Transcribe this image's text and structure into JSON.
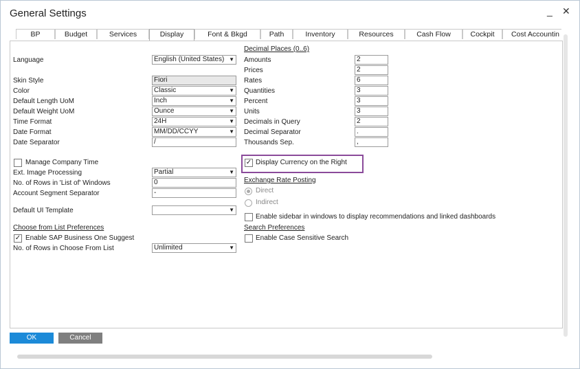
{
  "window": {
    "title": "General Settings",
    "minimize": "_",
    "close": "✕"
  },
  "tabs": [
    "BP",
    "Budget",
    "Services",
    "Display",
    "Font & Bkgd",
    "Path",
    "Inventory",
    "Resources",
    "Cash Flow",
    "Cockpit",
    "Cost Accountin"
  ],
  "left": {
    "language_label": "Language",
    "language_value": "English (United States)",
    "skin_label": "Skin Style",
    "skin_value": "Fiori",
    "color_label": "Color",
    "color_value": "Classic",
    "length_label": "Default Length UoM",
    "length_value": "Inch",
    "weight_label": "Default Weight UoM",
    "weight_value": "Ounce",
    "time_label": "Time Format",
    "time_value": "24H",
    "date_label": "Date Format",
    "date_value": "MM/DD/CCYY",
    "datesep_label": "Date Separator",
    "datesep_value": "/",
    "mct_label": "Manage Company Time",
    "ext_label": "Ext. Image Processing",
    "ext_value": "Partial",
    "rows_label": "No. of Rows in 'List of' Windows",
    "rows_value": "0",
    "seg_label": "Account Segment Separator",
    "seg_value": "-",
    "ui_label": "Default UI Template",
    "ui_value": "",
    "cfl_heading": "Choose from List Preferences",
    "suggest_label": "Enable SAP Business One Suggest",
    "cflrows_label": "No. of Rows in Choose From List",
    "cflrows_value": "Unlimited"
  },
  "right": {
    "decimal_heading": "Decimal Places  (0..6)",
    "amounts_label": "Amounts",
    "amounts_value": "2",
    "prices_label": "Prices",
    "prices_value": "2",
    "rates_label": "Rates",
    "rates_value": "6",
    "quant_label": "Quantities",
    "quant_value": "3",
    "percent_label": "Percent",
    "percent_value": "3",
    "units_label": "Units",
    "units_value": "3",
    "diq_label": "Decimals in Query",
    "diq_value": "2",
    "decsep_label": "Decimal Separator",
    "decsep_value": ".",
    "thousep_label": "Thousands Sep.",
    "thousep_value": ",",
    "currency_label": "Display Currency on the Right",
    "erp_heading": "Exchange Rate Posting",
    "direct_label": "Direct",
    "indirect_label": "Indirect",
    "sidebar_label": "Enable sidebar in windows to display recommendations and linked dashboards",
    "search_heading": "Search Preferences",
    "case_label": "Enable Case Sensitive Search"
  },
  "buttons": {
    "ok": "OK",
    "cancel": "Cancel"
  },
  "colors": {
    "ok": "#1c8ad8",
    "cancel": "#7f7f7f",
    "highlight": "#8a4a9a"
  }
}
